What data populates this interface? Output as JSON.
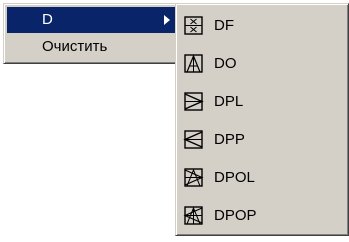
{
  "menu": {
    "items": [
      {
        "label": "D",
        "selected": true,
        "has_submenu": true
      },
      {
        "label": "Очистить",
        "selected": false,
        "has_submenu": false
      }
    ]
  },
  "submenu": {
    "items": [
      {
        "label": "DF",
        "icon": "df-icon"
      },
      {
        "label": "DO",
        "icon": "do-icon"
      },
      {
        "label": "DPL",
        "icon": "dpl-icon"
      },
      {
        "label": "DPP",
        "icon": "dpp-icon"
      },
      {
        "label": "DPOL",
        "icon": "dpol-icon"
      },
      {
        "label": "DPOP",
        "icon": "dpop-icon"
      }
    ]
  },
  "colors": {
    "menu_bg": "#d4d0c8",
    "highlight_bg": "#0a246a",
    "highlight_text": "#ffffff",
    "text": "#000000"
  }
}
